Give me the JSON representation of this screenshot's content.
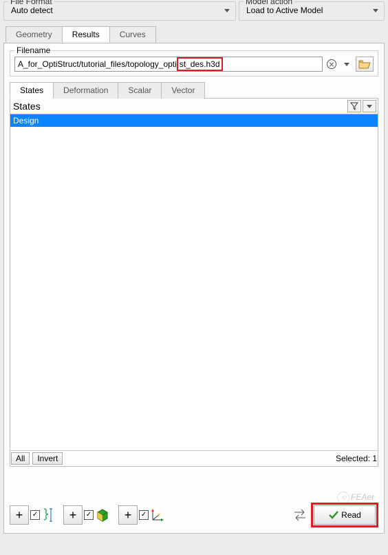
{
  "topbar": {
    "file_format_label": "File Format",
    "file_format_value": "Auto detect",
    "model_action_label": "Model action",
    "model_action_value": "Load to Active Model"
  },
  "main_tabs": {
    "geometry": "Geometry",
    "results": "Results",
    "curves": "Curves",
    "active": "results"
  },
  "filename": {
    "legend": "Filename",
    "value_prefix": "A_for_OptiStruct/tutorial_files/topology_opti",
    "value_highlight": "st_des.h3d"
  },
  "subtabs": {
    "states": "States",
    "deformation": "Deformation",
    "scalar": "Scalar",
    "vector": "Vector",
    "active": "states"
  },
  "states_panel": {
    "title": "States",
    "items": [
      "Design"
    ]
  },
  "list_footer": {
    "all": "All",
    "invert": "Invert",
    "selected_label": "Selected: 1"
  },
  "bottom": {
    "read_label": "Read"
  },
  "watermark": "FEAer"
}
